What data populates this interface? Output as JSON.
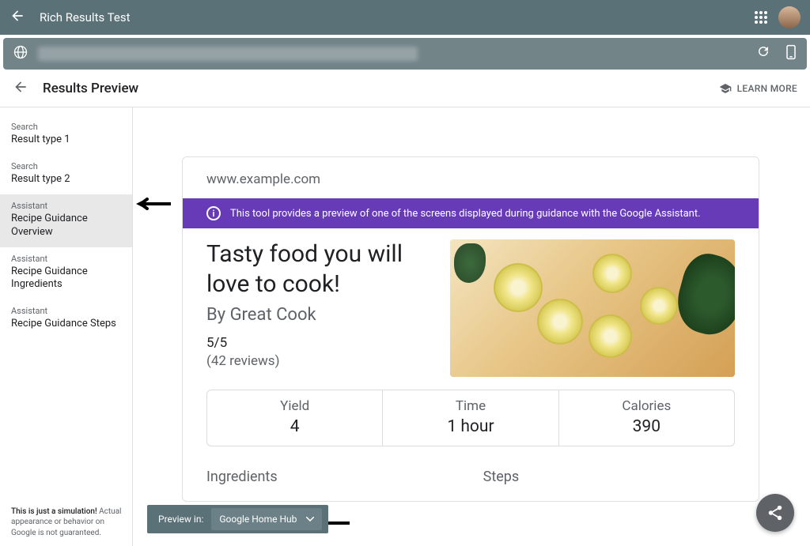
{
  "topbar": {
    "title": "Rich Results Test"
  },
  "subheader": {
    "title": "Results Preview",
    "learn_more": "LEARN MORE"
  },
  "sidebar": {
    "items": [
      {
        "category": "Search",
        "label": "Result type 1"
      },
      {
        "category": "Search",
        "label": "Result type 2"
      },
      {
        "category": "Assistant",
        "label": "Recipe Guidance Overview"
      },
      {
        "category": "Assistant",
        "label": "Recipe Guidance Ingredients"
      },
      {
        "category": "Assistant",
        "label": "Recipe Guidance Steps"
      }
    ],
    "disclaimer_bold": "This is just a simulation!",
    "disclaimer_rest": " Actual appearance or behavior on Google is not guaranteed."
  },
  "preview": {
    "domain": "www.example.com",
    "banner": "This tool provides a preview of one of the screens displayed during guidance with the Google Assistant.",
    "recipe": {
      "title": "Tasty food you will love to cook!",
      "author": "By Great Cook",
      "rating": "5/5",
      "reviews": "(42 reviews)",
      "stats": [
        {
          "label": "Yield",
          "value": "4"
        },
        {
          "label": "Time",
          "value": "1 hour"
        },
        {
          "label": "Calories",
          "value": "390"
        }
      ],
      "tabs": {
        "ingredients": "Ingredients",
        "steps": "Steps"
      }
    }
  },
  "preview_in": {
    "label": "Preview in:",
    "selected": "Google Home Hub"
  }
}
